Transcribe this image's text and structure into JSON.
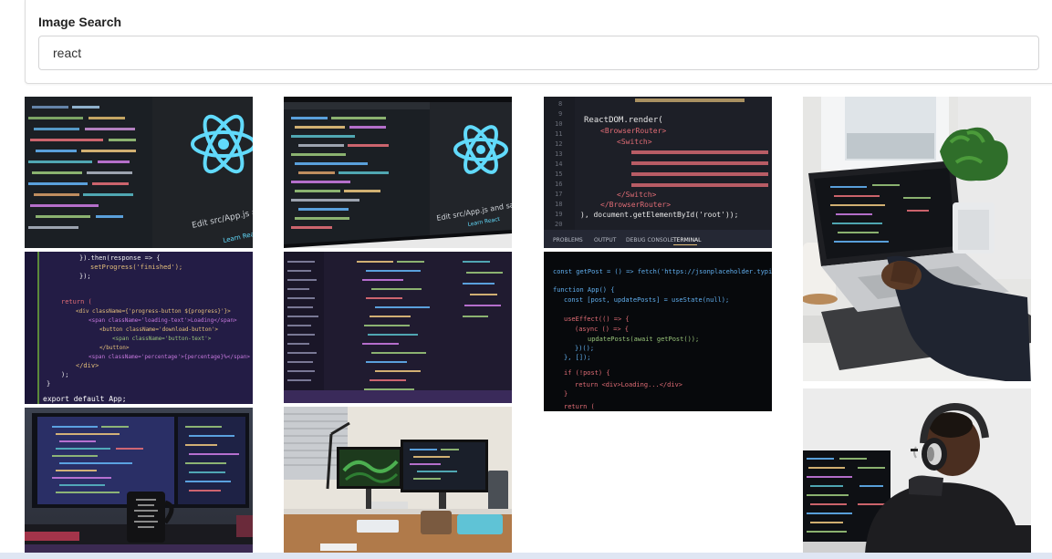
{
  "search": {
    "label": "Image Search",
    "value": "react",
    "placeholder": ""
  },
  "images": [
    {
      "subject": "react-logo-monitor",
      "lines": [
        "Edit src/App.js and save to",
        "Learn React"
      ]
    },
    {
      "subject": "react-logo-monitor-angled",
      "lines": [
        "Edit src/App.js and save to",
        "Learn React"
      ]
    },
    {
      "subject": "react-router-code",
      "lines": [
        "ReactDOM.render(",
        "<BrowserRouter>",
        "<Switch>",
        "</Switch>",
        "</BrowserRouter>",
        "), document.getElementById('root'));"
      ],
      "tabs": [
        "PROBLEMS",
        "OUTPUT",
        "DEBUG CONSOLE",
        "TERMINAL"
      ],
      "line_numbers": [
        "8",
        "9",
        "10",
        "11",
        "12",
        "13",
        "14",
        "15",
        "16",
        "17",
        "18",
        "19",
        "20"
      ]
    },
    {
      "subject": "person-laptop-plant"
    },
    {
      "subject": "progress-code-purple",
      "lines": [
        "}).then(response => {",
        "setProgress('finished');",
        "});",
        "return (",
        "<div className={'progress-button ${progress}'}>",
        "<span className='loading-text'>Loading</span>",
        "<button className='download-button'>",
        "<span className='button-text'>",
        "</button>",
        "<span className='percentage'>{percentage}%</span>",
        "</div>",
        ");",
        "}",
        "export default App;"
      ]
    },
    {
      "subject": "code-monitor-angled"
    },
    {
      "subject": "getpost-code-dark",
      "lines": [
        "const getPost = () => fetch('https://jsonplaceholder.typicode.com')",
        "function App() {",
        "const [post, updatePosts] = useState(null);",
        "useEffect(() => {",
        "(async () => {",
        "updatePosts(await getPost());",
        "})();",
        "}, []);",
        "if (!post) {",
        "return <div>Loading...</div>",
        "}",
        "return ("
      ]
    },
    {
      "subject": "person-headphones-monitor"
    },
    {
      "subject": "dual-monitor-desk-mug"
    },
    {
      "subject": "desk-setup-dual-monitors"
    }
  ]
}
